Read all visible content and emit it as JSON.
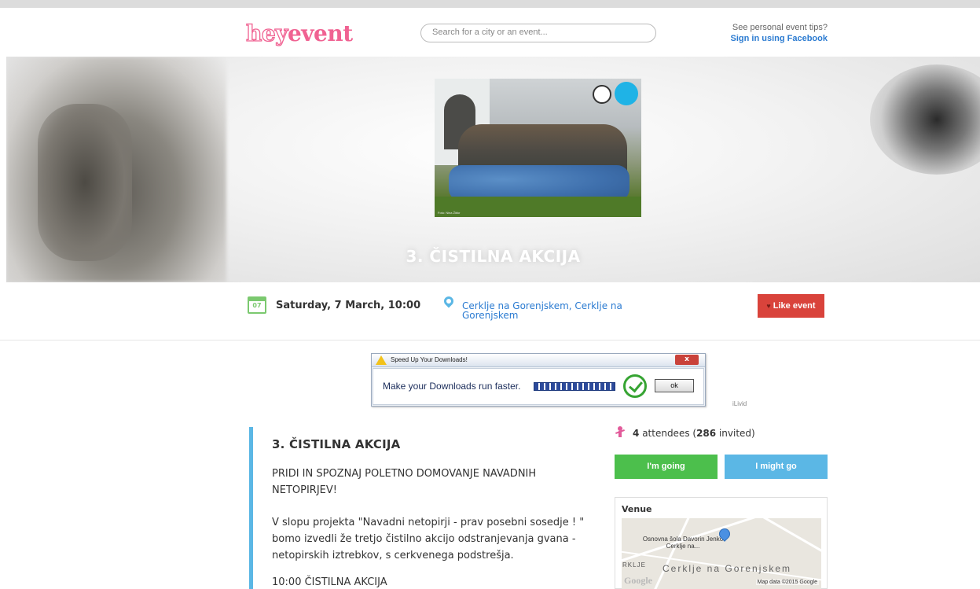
{
  "header": {
    "logo_hey": "hey",
    "logo_event": "event",
    "search_placeholder": "Search for a city or an event...",
    "tips_line1": "See personal event tips?",
    "tips_line2": "Sign in using Facebook"
  },
  "hero": {
    "title": "3. ČISTILNA AKCIJA",
    "photo_credit": "Foto: Nina Žibkr"
  },
  "info": {
    "calendar_day": "07",
    "date": "Saturday, 7 March, 10:00",
    "location": "Cerklje na Gorenjskem, Cerklje na Gorenjskem",
    "like_label": "Like event"
  },
  "ad": {
    "window_title": "Speed Up Your Downloads!",
    "close_label": "x",
    "message": "Make your Downloads run faster.",
    "ok_label": "ok",
    "credit": "iLivid"
  },
  "description": {
    "title": "3. ČISTILNA AKCIJA",
    "subtitle": "PRIDI IN SPOZNAJ POLETNO DOMOVANJE NAVADNIH NETOPIRJEV!",
    "body": "V slopu projekta \"Navadni netopirji - prav posebni sosedje ! \" bomo izvedli že tretjo čistilno akcijo odstranjevanja gvana - netopirskih iztrebkov, s cerkvenega podstrešja.",
    "time_line": "10:00 ČISTILNA AKCIJA"
  },
  "attendance": {
    "attendees_count": "4",
    "attendees_label": "attendees (",
    "invited_count": "286",
    "invited_label": "invited)",
    "going_label": "I'm going",
    "might_label": "I might go"
  },
  "venue": {
    "title": "Venue",
    "map_school": "Osnovna šola Davorin Jenko Cerklje na...",
    "map_rkl": "RKLJE",
    "map_town": "Cerklje na Gorenjskem",
    "map_google": "Google",
    "map_data": "Map data ©2015 Google"
  },
  "colors": {
    "brand_pink": "#f06292",
    "link_blue": "#2b7bd1",
    "like_red": "#d9433b",
    "going_green": "#4cbf4c",
    "might_blue": "#5bb7e5"
  }
}
